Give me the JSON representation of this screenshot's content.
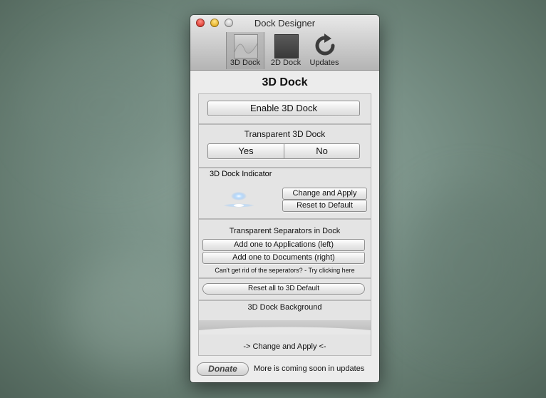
{
  "window": {
    "title": "Dock Designer"
  },
  "toolbar": {
    "items": [
      {
        "label": "3D Dock",
        "icon": "3d-dock-icon",
        "selected": true
      },
      {
        "label": "2D Dock",
        "icon": "2d-dock-icon"
      },
      {
        "label": "Updates",
        "icon": "refresh-arrow-icon"
      }
    ]
  },
  "page": {
    "heading": "3D Dock"
  },
  "enable_section": {
    "button": "Enable 3D Dock"
  },
  "transparent_section": {
    "title": "Transparent 3D Dock",
    "yes": "Yes",
    "no": "No"
  },
  "indicator_section": {
    "title": "3D Dock Indicator",
    "change": "Change and Apply",
    "reset": "Reset to Default"
  },
  "separators_section": {
    "title": "Transparent Separators in Dock",
    "add_apps": "Add one to Applications (left)",
    "add_docs": "Add one to Documents (right)",
    "hint": "Can't get rid of the seperators? - Try clicking here"
  },
  "reset_section": {
    "button": "Reset all to 3D Default"
  },
  "background_section": {
    "title": "3D Dock Background",
    "apply": "-> Change and Apply <-"
  },
  "footer": {
    "donate": "Donate",
    "soon": "More is coming soon in updates"
  }
}
